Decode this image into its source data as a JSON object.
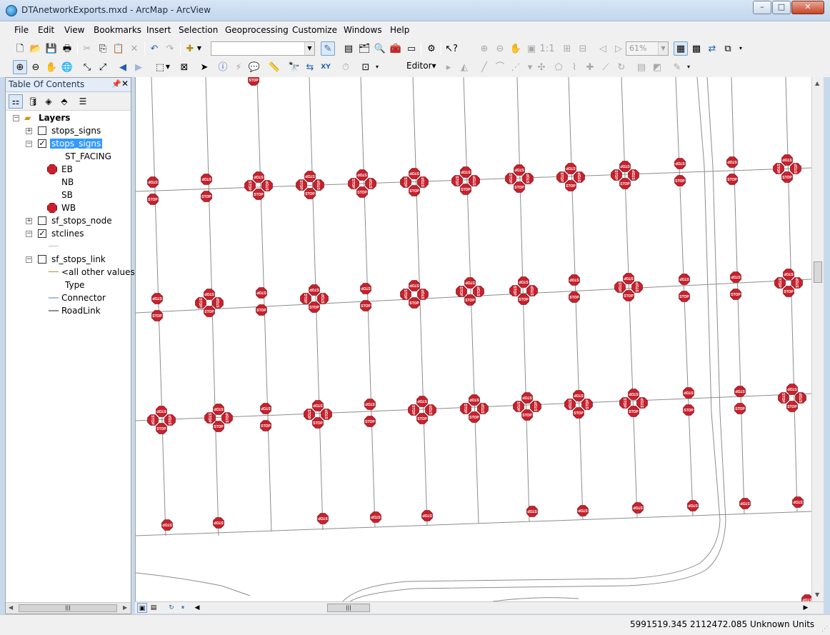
{
  "window": {
    "title": "DTAnetworkExports.mxd - ArcMap - ArcView",
    "minimize": "–",
    "maximize": "□",
    "close": "✕"
  },
  "menu": [
    "File",
    "Edit",
    "View",
    "Bookmarks",
    "Insert",
    "Selection",
    "Geoprocessing",
    "Customize",
    "Windows",
    "Help"
  ],
  "toolbar": {
    "zoom_level": "61%",
    "editor_label": "Editor▾"
  },
  "toc": {
    "title": "Table Of Contents",
    "root": "Layers",
    "layers": [
      {
        "name": "stops_signs",
        "checked": false,
        "expanded": false
      },
      {
        "name": "stops_signs",
        "checked": true,
        "expanded": true,
        "selected": true,
        "field": "ST_FACING",
        "classes": [
          "EB",
          "NB",
          "SB",
          "WB"
        ]
      },
      {
        "name": "sf_stops_node",
        "checked": false,
        "expanded": false
      },
      {
        "name": "stclines",
        "checked": true,
        "expanded": true
      },
      {
        "name": "sf_stops_link",
        "checked": false,
        "expanded": true,
        "default_value": "<all other values>",
        "field": "Type",
        "classes": [
          "Connector",
          "RoadLink"
        ]
      }
    ]
  },
  "map": {
    "sign_label": "STOP",
    "sign_color": "#c8212d",
    "road_color": "#8c8c8c"
  },
  "status": {
    "coordinates": "5991519.345  2112472.085 Unknown Units"
  },
  "icons": [
    "arcmap-app-icon",
    "new-document-icon",
    "open-folder-icon",
    "save-icon",
    "print-icon",
    "cut-icon",
    "copy-icon",
    "paste-icon",
    "delete-icon",
    "undo-icon",
    "redo-icon",
    "add-data-icon",
    "zoom-in-icon",
    "zoom-out-icon",
    "pan-icon",
    "full-extent-icon",
    "select-arrow-icon",
    "identify-icon",
    "find-binoculars-icon",
    "go-to-xy-icon",
    "stop-sign-icon"
  ]
}
